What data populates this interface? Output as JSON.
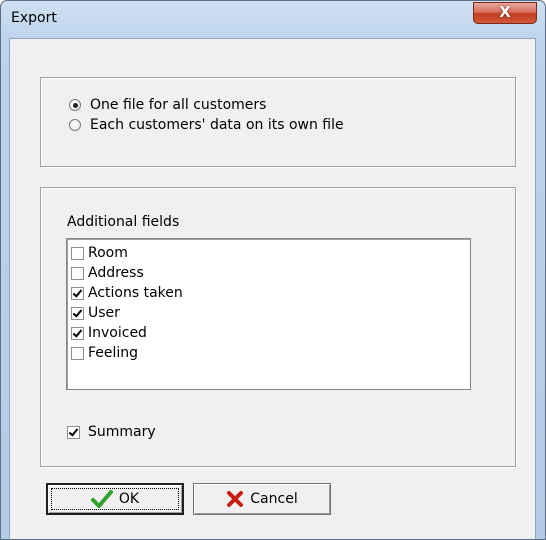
{
  "window": {
    "title": "Export",
    "close_glyph": "X"
  },
  "output_mode": {
    "options": [
      {
        "label": "One file for all customers",
        "selected": true
      },
      {
        "label": "Each customers' data on its own file",
        "selected": false
      }
    ]
  },
  "additional_fields": {
    "label": "Additional fields",
    "items": [
      {
        "label": "Room",
        "checked": false
      },
      {
        "label": "Address",
        "checked": false
      },
      {
        "label": "Actions taken",
        "checked": true
      },
      {
        "label": "User",
        "checked": true
      },
      {
        "label": "Invoiced",
        "checked": true
      },
      {
        "label": "Feeling",
        "checked": false
      }
    ]
  },
  "summary": {
    "label": "Summary",
    "checked": true
  },
  "buttons": {
    "ok_label": "OK",
    "ok_icon": "check-icon",
    "cancel_label": "Cancel",
    "cancel_icon": "x-icon"
  },
  "colors": {
    "ok_icon": "#2fa12a",
    "cancel_icon": "#c81e10",
    "close_button": "#c94a2f"
  }
}
